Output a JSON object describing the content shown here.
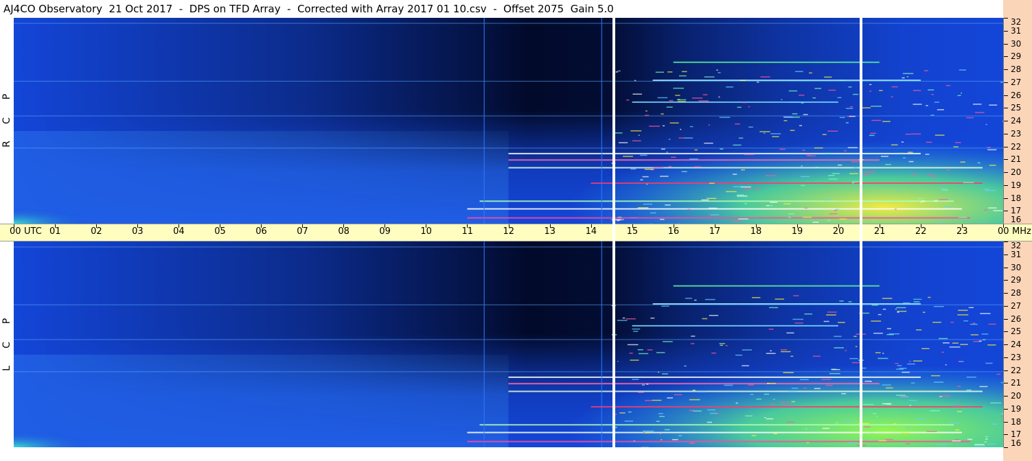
{
  "header": {
    "title": "AJ4CO Observatory  21 Oct 2017  -  DPS on TFD Array  -  Corrected with Array 2017 01 10.csv  -  Offset 2075  Gain 5.0"
  },
  "panels": [
    {
      "id": "rcp",
      "letters": [
        "P",
        "C",
        "R"
      ]
    },
    {
      "id": "lcp",
      "letters": [
        "P",
        "C",
        "L"
      ]
    }
  ],
  "colors": {
    "background_blue": "#1446d8",
    "dark_region": "#020a2a",
    "bright_green": "#3cff7a",
    "yellow": "#fff23a",
    "axis_fill": "#fffec0",
    "mhz_strip": "#fbd5b8"
  },
  "chart_data": {
    "type": "heatmap",
    "title": "AJ4CO Observatory  21 Oct 2017  -  DPS on TFD Array  -  Corrected with Array 2017 01 10.csv  -  Offset 2075  Gain 5.0",
    "x_unit": "UTC",
    "y_unit": "MHz",
    "x_ticks": [
      "00",
      "01",
      "02",
      "03",
      "04",
      "05",
      "06",
      "07",
      "08",
      "09",
      "10",
      "11",
      "12",
      "13",
      "14",
      "15",
      "16",
      "17",
      "18",
      "19",
      "20",
      "21",
      "22",
      "23",
      "00"
    ],
    "x_range_hours": [
      0,
      24
    ],
    "y_ticks": [
      16,
      17,
      18,
      19,
      20,
      21,
      22,
      23,
      24,
      25,
      26,
      27,
      28,
      29,
      30,
      31,
      32
    ],
    "y_range": [
      16,
      32
    ],
    "panels": [
      "RCP",
      "LCP"
    ],
    "white_gaps_utc": [
      14.55,
      20.55
    ]
  }
}
